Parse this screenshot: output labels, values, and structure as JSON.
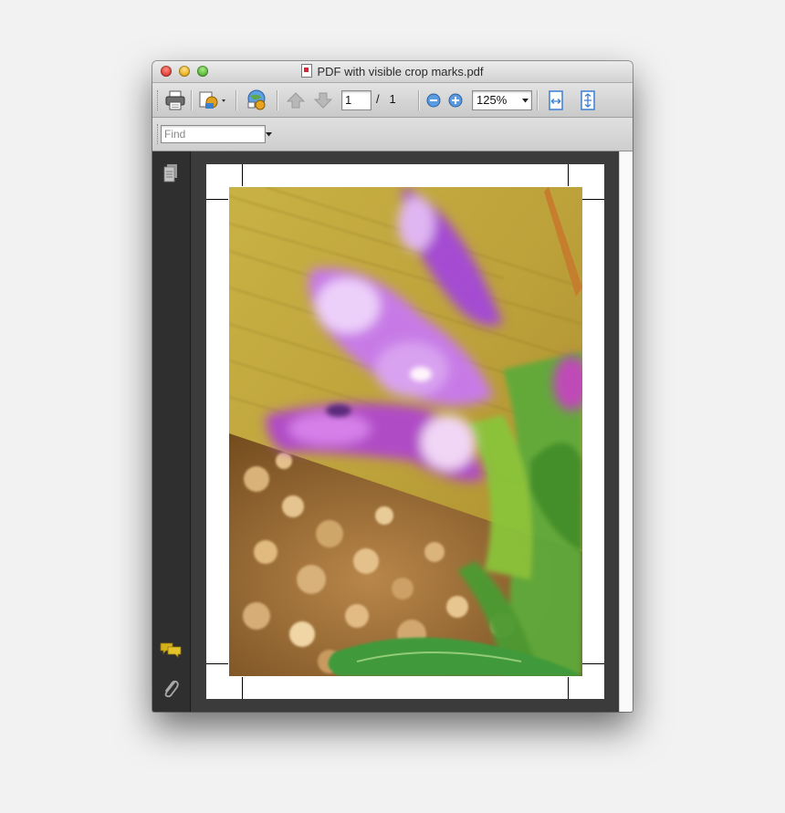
{
  "window": {
    "title": "PDF with visible crop marks.pdf"
  },
  "toolbar": {
    "page_current": "1",
    "page_separator": "/",
    "page_total": "1",
    "zoom": "125%"
  },
  "findbar": {
    "placeholder": "Find"
  },
  "icons": {
    "print": "printer-icon",
    "share": "share-icon",
    "web": "globe-icon",
    "prev": "arrow-up-icon",
    "next": "arrow-down-icon",
    "zoom_out": "zoom-out-icon",
    "zoom_in": "zoom-in-icon",
    "fit_width": "fit-width-icon",
    "fit_page": "fit-page-icon",
    "pages_panel": "pages-icon",
    "comments_panel": "comments-icon",
    "attachments_panel": "paperclip-icon"
  },
  "colors": {
    "accent_blue": "#3b7fd1",
    "comment_yellow": "#d6b11c",
    "sidebar_bg": "#2f2f2f"
  }
}
